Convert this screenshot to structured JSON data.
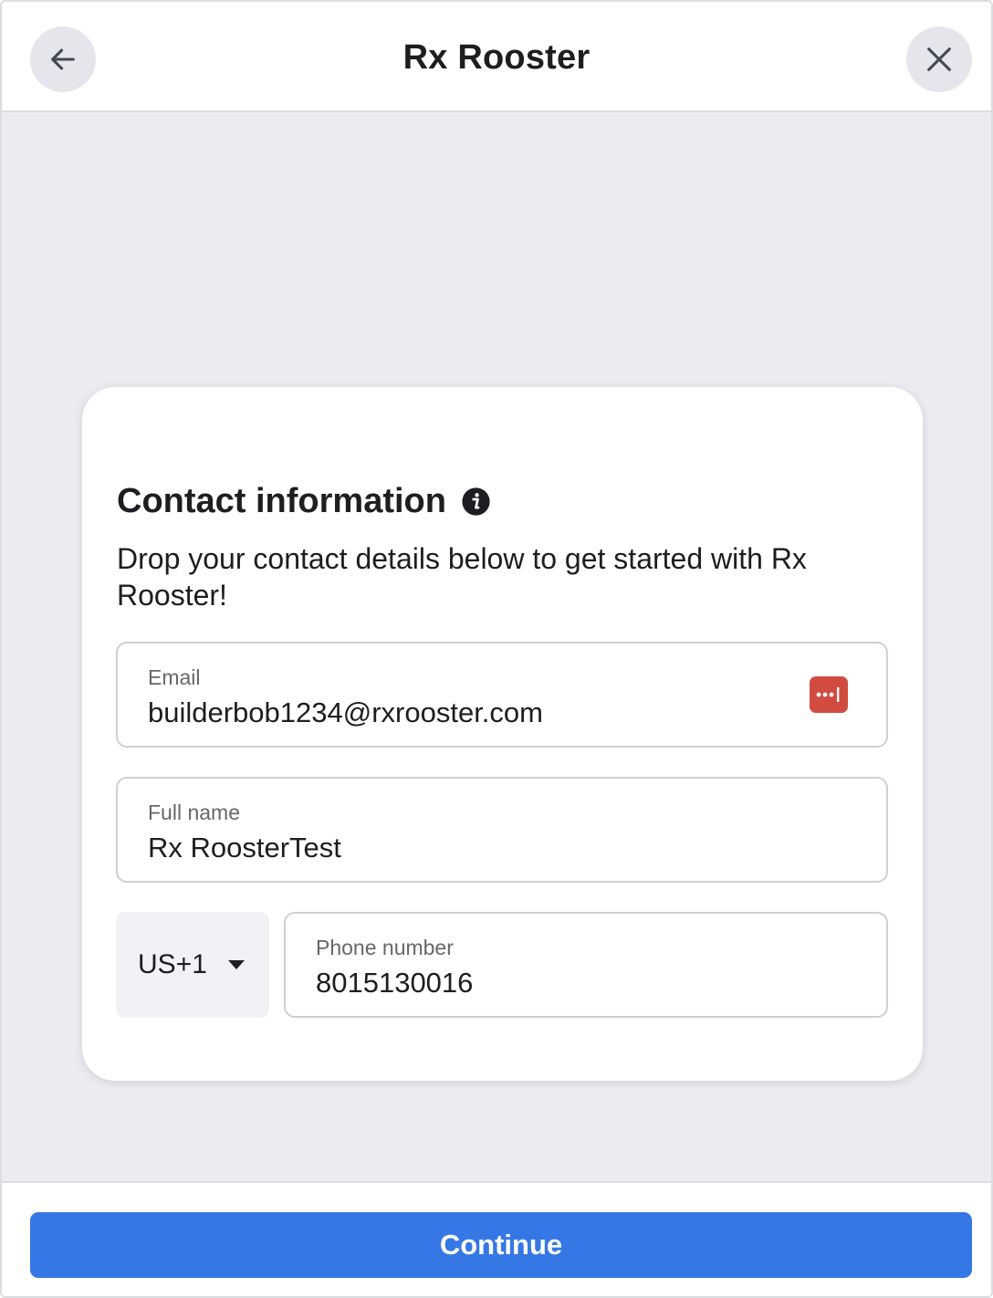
{
  "header": {
    "title": "Rx Rooster",
    "back_icon": "arrow-left-icon",
    "close_icon": "close-icon"
  },
  "card": {
    "title": "Contact information",
    "info_icon": "info-icon",
    "description": "Drop your contact details below to get started with Rx Rooster!"
  },
  "form": {
    "email": {
      "label": "Email",
      "value": "builderbob1234@rxrooster.com",
      "autofill_icon": "password-manager-icon"
    },
    "full_name": {
      "label": "Full name",
      "value": "Rx RoosterTest"
    },
    "country_code": {
      "value": "US+1",
      "icon": "caret-down-icon"
    },
    "phone": {
      "label": "Phone number",
      "value": "8015130016"
    }
  },
  "footer": {
    "continue_label": "Continue"
  },
  "colors": {
    "primary": "#3578e5",
    "background": "#ebecf0",
    "autofill_badge": "#d24b40"
  }
}
